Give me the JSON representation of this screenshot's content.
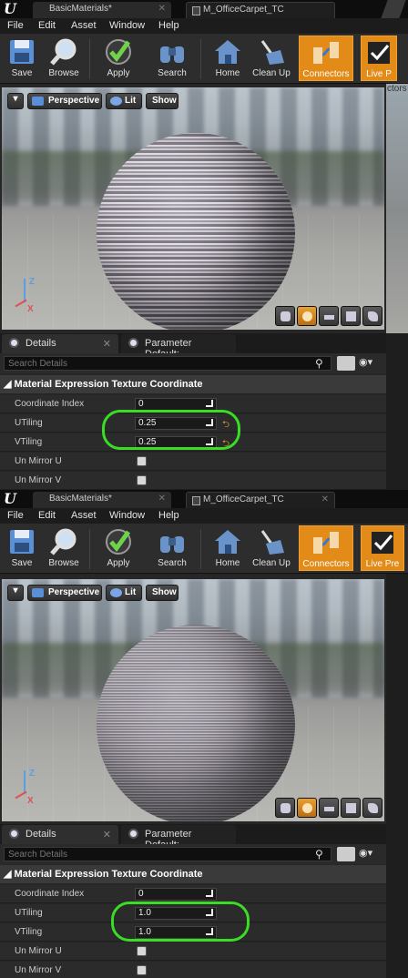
{
  "panels": [
    {
      "tabs": [
        {
          "label": "BasicMaterials*"
        },
        {
          "label": "M_OfficeCarpet_TC"
        }
      ],
      "menu": [
        "File",
        "Edit",
        "Asset",
        "Window",
        "Help"
      ],
      "toolbar": [
        "Save",
        "Browse",
        "Apply",
        "Search",
        "Home",
        "Clean Up",
        "Connectors",
        "Live P"
      ],
      "viewport": {
        "perspective": "Perspective",
        "lit": "Lit",
        "show": "Show",
        "axis_z": "Z",
        "axis_x": "X"
      },
      "details_tab": "Details",
      "params_tab": "Parameter Default:",
      "search_placeholder": "Search Details",
      "category": "Material Expression Texture Coordinate",
      "props": [
        {
          "label": "Coordinate Index",
          "value": "0"
        },
        {
          "label": "UTiling",
          "value": "0.25"
        },
        {
          "label": "VTiling",
          "value": "0.25"
        },
        {
          "label": "Un Mirror U",
          "value": ""
        },
        {
          "label": "Un Mirror V",
          "value": ""
        }
      ],
      "behind_text": "ctors"
    },
    {
      "tabs": [
        {
          "label": "BasicMaterials*"
        },
        {
          "label": "M_OfficeCarpet_TC"
        }
      ],
      "menu": [
        "File",
        "Edit",
        "Asset",
        "Window",
        "Help"
      ],
      "toolbar": [
        "Save",
        "Browse",
        "Apply",
        "Search",
        "Home",
        "Clean Up",
        "Connectors",
        "Live Pre"
      ],
      "viewport": {
        "perspective": "Perspective",
        "lit": "Lit",
        "show": "Show",
        "axis_z": "Z",
        "axis_x": "X"
      },
      "details_tab": "Details",
      "params_tab": "Parameter Default:",
      "search_placeholder": "Search Details",
      "category": "Material Expression Texture Coordinate",
      "props": [
        {
          "label": "Coordinate Index",
          "value": "0"
        },
        {
          "label": "UTiling",
          "value": "1.0"
        },
        {
          "label": "VTiling",
          "value": "1.0"
        },
        {
          "label": "Un Mirror U",
          "value": ""
        },
        {
          "label": "Un Mirror V",
          "value": ""
        }
      ]
    }
  ],
  "colors": {
    "accent": "#e38b18",
    "highlight": "#3adc25",
    "background": "#262626"
  }
}
